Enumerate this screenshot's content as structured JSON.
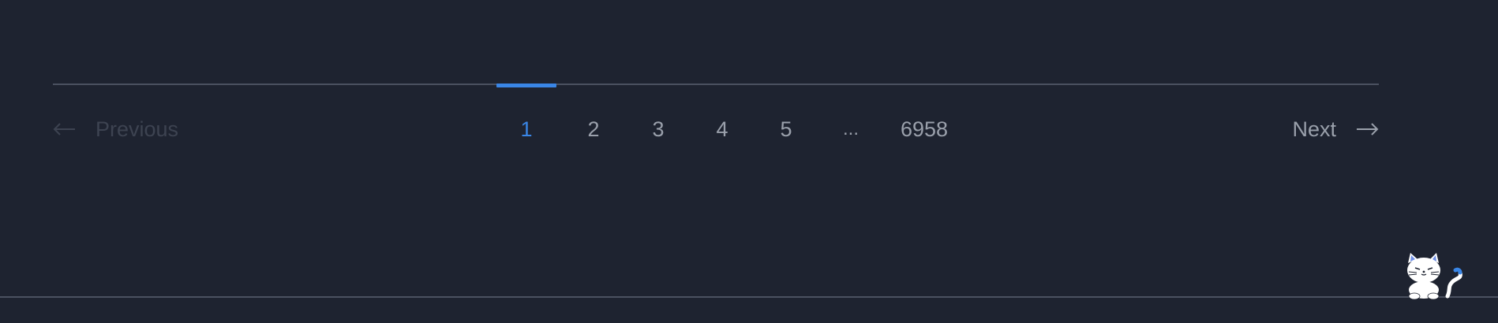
{
  "pagination": {
    "previous_label": "Previous",
    "next_label": "Next",
    "pages": [
      "1",
      "2",
      "3",
      "4",
      "5"
    ],
    "ellipsis": "...",
    "last_page": "6958",
    "current_page": "1",
    "previous_disabled": true
  },
  "icons": {
    "previous": "arrow-left-icon",
    "next": "arrow-right-icon",
    "mascot": "cat-mascot-icon"
  },
  "colors": {
    "background": "#1e2330",
    "accent": "#3a86e6",
    "text": "#9aa0ab",
    "text_disabled": "#3d4351",
    "rule": "#4b5160"
  }
}
